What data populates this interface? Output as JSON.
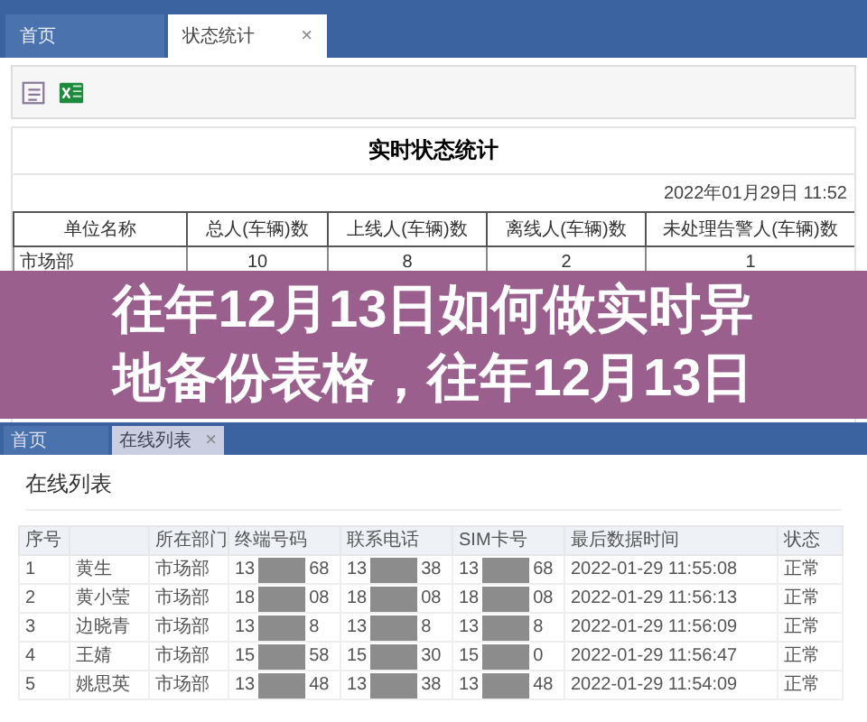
{
  "tabs": [
    {
      "label": "首页",
      "selected": false
    },
    {
      "label": "状态统计",
      "selected": true,
      "close": "×"
    }
  ],
  "report": {
    "title": "实时状态统计",
    "datetime": "2022年01月29日  11:52",
    "columns": [
      "单位名称",
      "总人(车辆)数",
      "上线人(车辆)数",
      "离线人(车辆)数",
      "未处理告警人(车辆)数"
    ],
    "rows": [
      [
        "市场部",
        "10",
        "8",
        "2",
        "1"
      ]
    ]
  },
  "banner": {
    "lines": [
      "往年12月13日如何做实时异",
      "地备份表格，往年12月13日"
    ]
  },
  "second_tabs": [
    {
      "label": "首页",
      "selected": false
    },
    {
      "label": "在线列表",
      "selected": true,
      "close": "×"
    }
  ],
  "online": {
    "heading": "在线列表",
    "columns": [
      "序号",
      "",
      "所在部门",
      "终端号码",
      "联系电话",
      "SIM卡号",
      "最后数据时间",
      "状态"
    ],
    "rows": [
      {
        "no": "1",
        "name": "黄生",
        "dept": "市场部",
        "phones": [
          [
            "13",
            "68"
          ],
          [
            "13",
            "38"
          ],
          [
            "13",
            "68"
          ]
        ],
        "time": "2022-01-29 11:55:08",
        "status": "正常"
      },
      {
        "no": "2",
        "name": "黄小莹",
        "dept": "市场部",
        "phones": [
          [
            "18",
            "08"
          ],
          [
            "18",
            "08"
          ],
          [
            "18",
            "08"
          ]
        ],
        "time": "2022-01-29 11:56:13",
        "status": "正常"
      },
      {
        "no": "3",
        "name": "边晓青",
        "dept": "市场部",
        "phones": [
          [
            "13",
            "8"
          ],
          [
            "13",
            "8"
          ],
          [
            "13",
            "8"
          ]
        ],
        "time": "2022-01-29 11:56:09",
        "status": "正常"
      },
      {
        "no": "4",
        "name": "王婧",
        "dept": "市场部",
        "phones": [
          [
            "15",
            "58"
          ],
          [
            "15",
            "30"
          ],
          [
            "15",
            "0"
          ]
        ],
        "time": "2022-01-29 11:56:47",
        "status": "正常"
      },
      {
        "no": "5",
        "name": "姚思英",
        "dept": "市场部",
        "phones": [
          [
            "13",
            "48"
          ],
          [
            "13",
            "38"
          ],
          [
            "13",
            "48"
          ]
        ],
        "time": "2022-01-29 11:54:09",
        "status": "正常"
      }
    ]
  }
}
